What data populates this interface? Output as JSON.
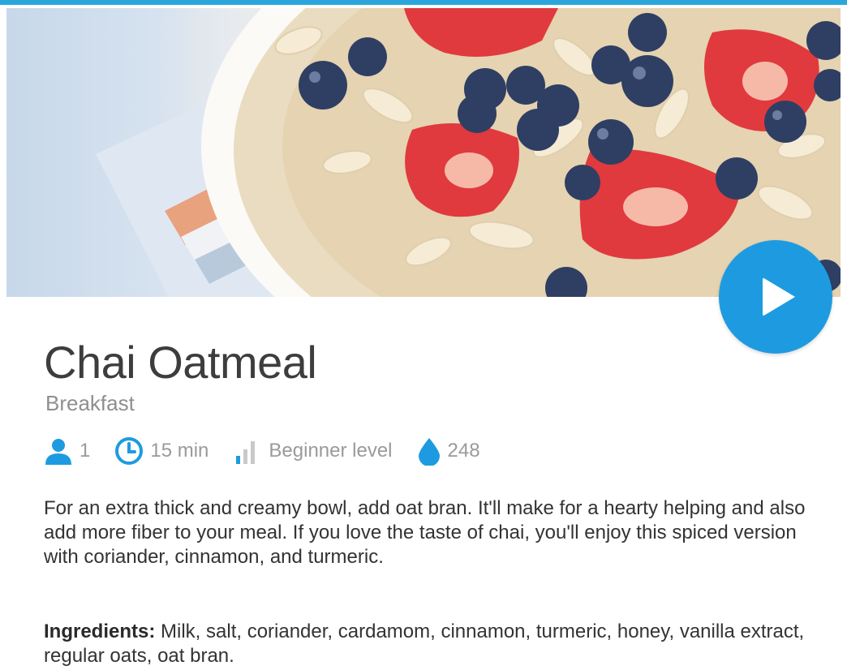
{
  "recipe": {
    "title": "Chai Oatmeal",
    "category": "Breakfast",
    "servings": "1",
    "time": "15 min",
    "level": "Beginner level",
    "calories": "248",
    "description": "For an extra thick and creamy bowl, add oat bran. It'll make for a hearty helping and also add more fiber to your meal. If you love the taste of chai, you'll enjoy this spiced version with coriander, cinnamon, and turmeric.",
    "ingredients_label": "Ingredients:",
    "ingredients": "Milk, salt, coriander, cardamom, cinnamon, turmeric, honey, vanilla extract, regular oats, oat bran."
  },
  "icons": {
    "servings": "person-icon",
    "time": "clock-icon",
    "level": "signal-bars-icon",
    "calories": "water-drop-icon",
    "play": "play-icon"
  },
  "colors": {
    "accent": "#1e9be0",
    "title_text": "#3d3d3d",
    "muted_text": "#9a9a9a",
    "body_text": "#333333"
  }
}
